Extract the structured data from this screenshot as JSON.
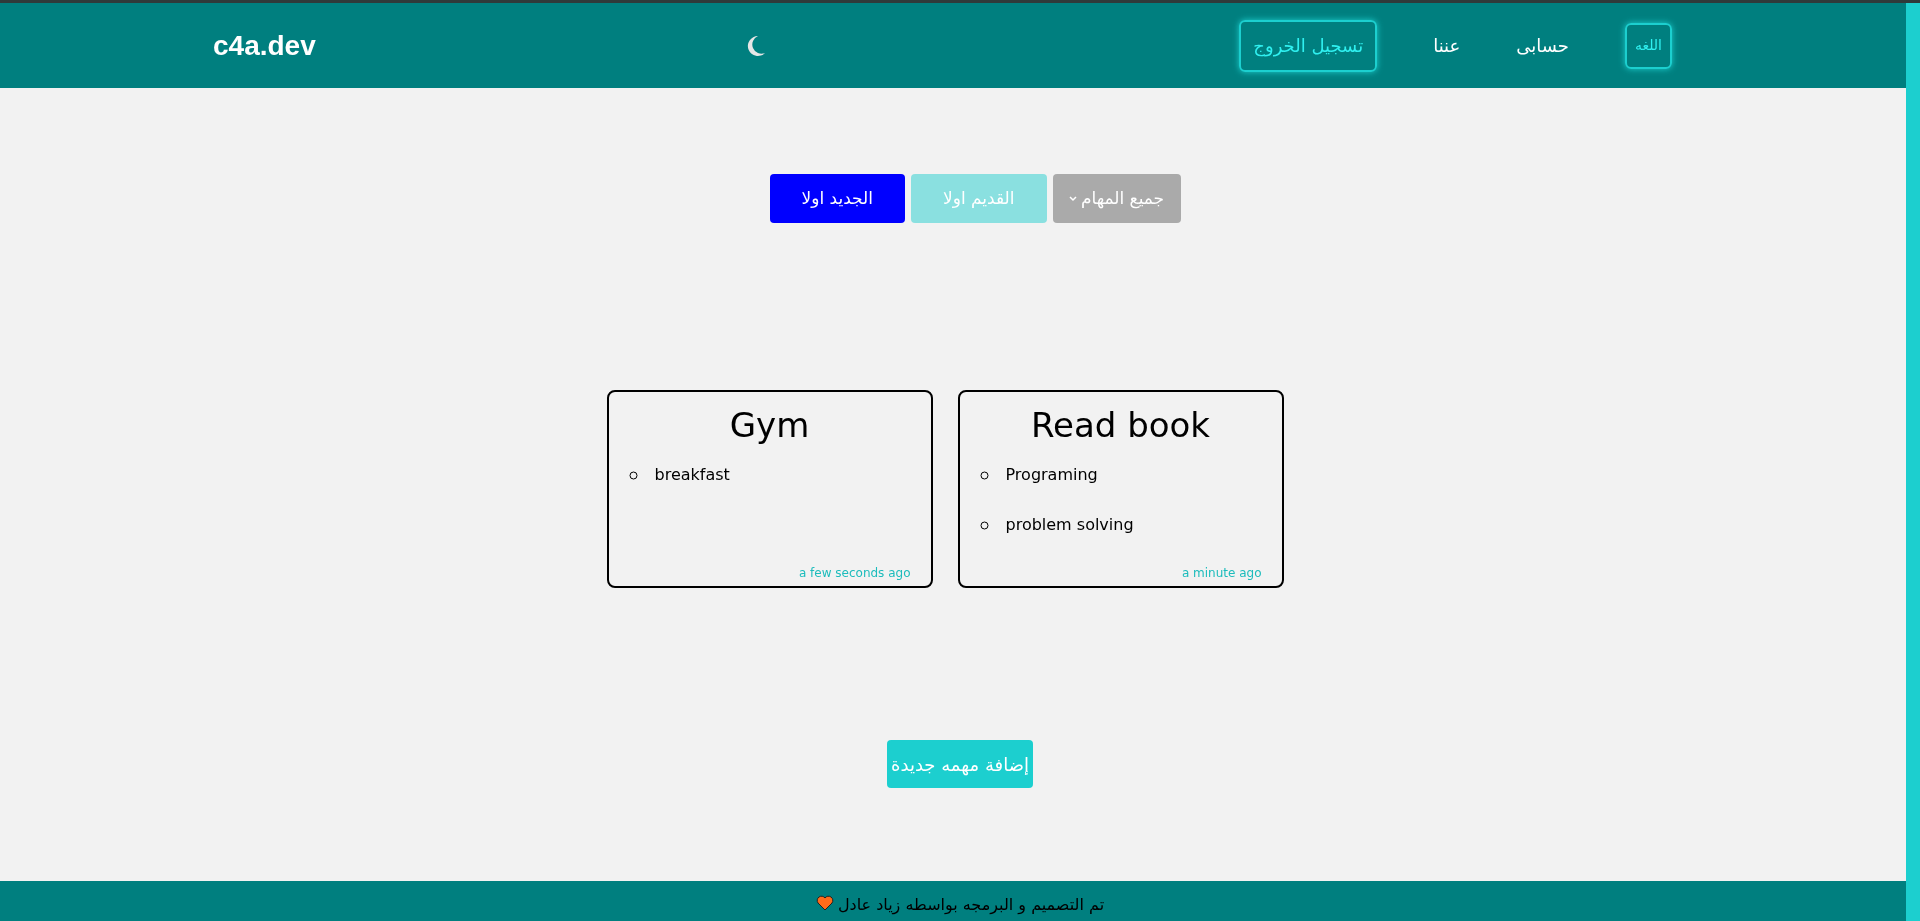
{
  "header": {
    "logo": "c4a.dev",
    "nav": [
      {
        "kind": "outlined",
        "label": "اللغه"
      },
      {
        "kind": "link",
        "label": "حسابى"
      },
      {
        "kind": "link",
        "label": "عننا"
      },
      {
        "kind": "outlined",
        "label": "تسجيل الخروج"
      }
    ]
  },
  "toolbar": {
    "filter": {
      "value": "جميع المهام"
    },
    "sort": [
      {
        "label": "القديم اولا",
        "selected": false
      },
      {
        "label": "الجديد اولا",
        "selected": true
      }
    ]
  },
  "cards": [
    {
      "title": "Read book",
      "items": [
        "Programing",
        "problem solving"
      ],
      "time": "a minute ago"
    },
    {
      "title": "Gym",
      "items": [
        "breakfast"
      ],
      "time": "a few seconds ago"
    }
  ],
  "add_button": "إضافة مهمه جديدة",
  "footer": {
    "text": "تم التصميم و البرمجه بواسطه زياد عادل"
  }
}
